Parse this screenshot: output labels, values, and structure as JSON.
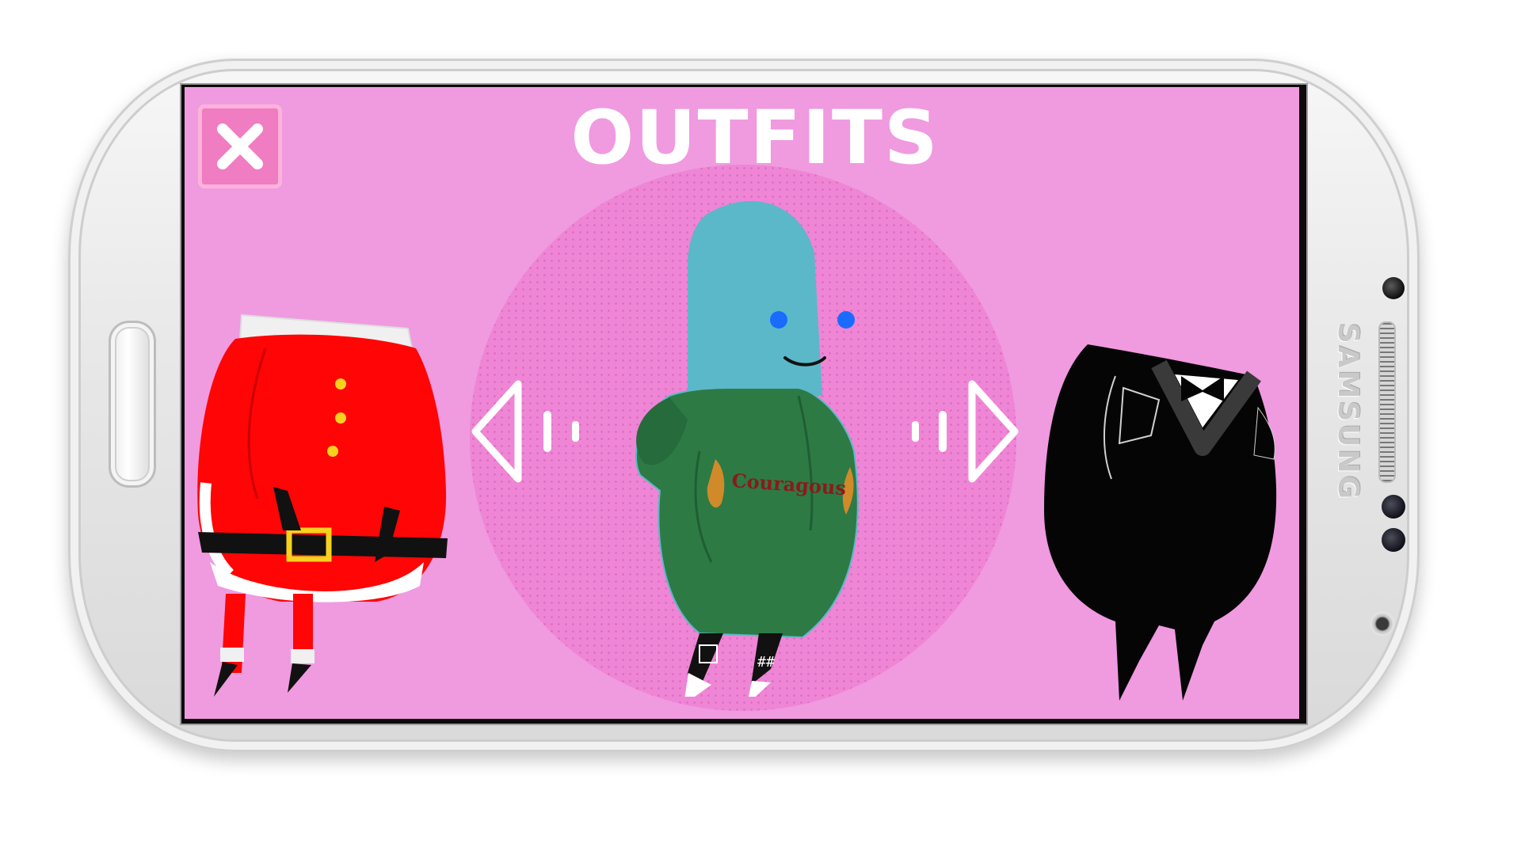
{
  "header": {
    "title": "OUTFITS"
  },
  "phone": {
    "brand": "SAMSUNG"
  },
  "carousel": {
    "selected_outfit": {
      "shirt_text": "Couragous"
    },
    "left_arrow_icon": "chevron-left-icon",
    "right_arrow_icon": "chevron-right-icon"
  },
  "colors": {
    "screen_background": "#f09ae0",
    "spotlight": "#ee86d5",
    "close_button": "#f07cc1",
    "hoodie": "#2d7a45",
    "character_head": "#5bb8c8"
  }
}
